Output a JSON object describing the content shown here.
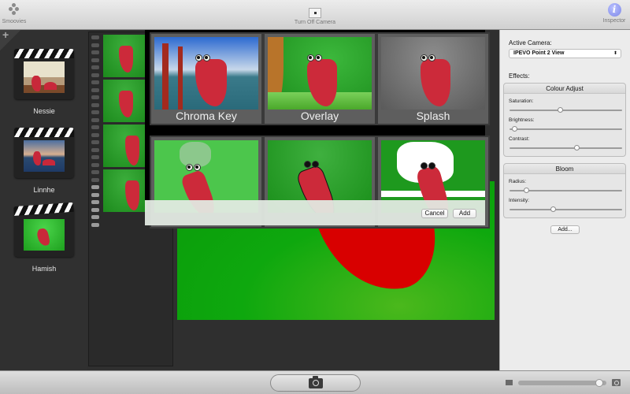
{
  "toolbar": {
    "smoovies_label": "Smoovies",
    "camera_label": "Turn Off Camera",
    "inspector_label": "Inspector"
  },
  "projects": [
    {
      "name": "Nessie"
    },
    {
      "name": "Linnhe"
    },
    {
      "name": "Hamish"
    }
  ],
  "add_project_symbol": "+",
  "effects_browser": {
    "effects": [
      {
        "label": "Chroma Key"
      },
      {
        "label": "Overlay"
      },
      {
        "label": "Splash"
      },
      {
        "label": ""
      },
      {
        "label": ""
      },
      {
        "label": ""
      }
    ],
    "cancel_label": "Cancel",
    "add_label": "Add"
  },
  "inspector": {
    "active_camera_label": "Active Camera:",
    "active_camera_value": "IPEVO Point 2 View",
    "select_arrows": "⬍",
    "effects_label": "Effects:",
    "groups": [
      {
        "title": "Colour Adjust",
        "params": [
          {
            "label": "Saturation:",
            "value": 0.45
          },
          {
            "label": "Brightness:",
            "value": 0.02
          },
          {
            "label": "Contrast:",
            "value": 0.6
          }
        ]
      },
      {
        "title": "Bloom",
        "params": [
          {
            "label": "Radius:",
            "value": 0.13
          },
          {
            "label": "Intensity:",
            "value": 0.38
          }
        ]
      }
    ],
    "add_effect_label": "Add..."
  },
  "bottombar": {
    "thumbnail_size": 0.96
  }
}
